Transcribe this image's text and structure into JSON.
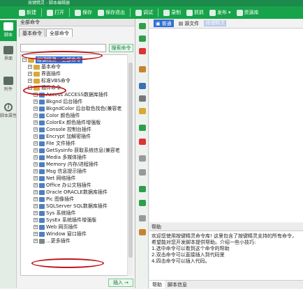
{
  "window": {
    "title": "按键精灵 - 脚本编辑器"
  },
  "toolbar": [
    {
      "label": "新建"
    },
    {
      "label": "打开"
    },
    {
      "label": "保存"
    },
    {
      "label": "保存退出"
    },
    {
      "label": "调试"
    },
    {
      "label": "录制"
    },
    {
      "label": "抓抓"
    },
    {
      "label": "发布"
    },
    {
      "label": "资源库"
    }
  ],
  "nav": [
    {
      "label": "脚本"
    },
    {
      "label": "界面"
    },
    {
      "label": "附件"
    },
    {
      "label": "脚本属性"
    }
  ],
  "panel": {
    "header": "全部命令",
    "tabs": [
      "基本命令",
      "全部命令"
    ],
    "search_placeholder": "",
    "search_button": "搜索命令",
    "insert_button": "插入 →"
  },
  "tree": {
    "root": "按键精灵 - 全部命令",
    "basic": "基本命令",
    "ui": "界面插件",
    "vbs": "标准VBS命令",
    "plugins": "插件命令",
    "items": [
      "Access ACCESS数据库插件",
      "Bkgnd 后台插件",
      "BkgndColor 后台取色找色(兼容老",
      "Color 颜色插件",
      "ColorEx 颜色插件增强版",
      "Console 控制台插件",
      "Encrypt 加解密插件",
      "File 文件插件",
      "GetSysInfo 获取系统信息(兼容老",
      "Media 多媒体插件",
      "Memory 内存/进程插件",
      "Msg 信息提示插件",
      "Net 网络插件",
      "Office 办公文档插件",
      "Oracle ORACLE数据库插件",
      "Pic 图像插件",
      "SQLServer SQL数据库插件",
      "Sys 系统插件",
      "SysEx 系统插件增强版",
      "Web 网页插件",
      "Window 窗口插件",
      "...更多插件"
    ]
  },
  "editor": {
    "tabs": [
      "普通",
      "源文件"
    ],
    "selected_text": "按键精灵"
  },
  "help": {
    "title": "帮助",
    "text": "欢迎您使用按键精灵命令库! 这里包含了按键精灵支持的所有命令，希望能对您开发脚本提供帮助。介绍一些小技巧:",
    "tips": [
      "1.选中命令可以看到这个命令的帮助",
      "2.双击命令可以直接插入到代码里",
      "3.",
      "4.四击命令可以插入代码。"
    ],
    "tabs": [
      "帮助",
      "脚本信息"
    ]
  }
}
